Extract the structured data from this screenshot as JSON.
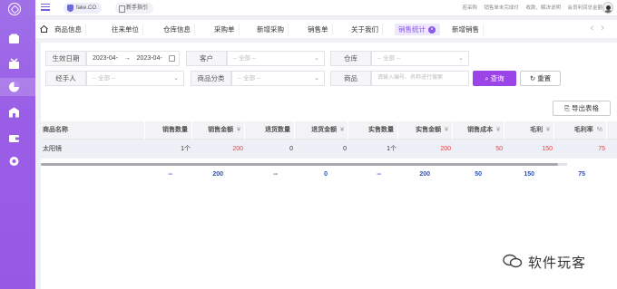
{
  "topbar": {
    "brand": "fake.CO",
    "guide": "新手指引",
    "right_items": [
      "若采购",
      "销售单未完成付",
      "收款、解决说明",
      "会员利润总金额"
    ]
  },
  "tabs": [
    {
      "label": "商品信息",
      "active": false
    },
    {
      "label": "往来单位",
      "active": false
    },
    {
      "label": "仓库信息",
      "active": false
    },
    {
      "label": "采购单",
      "active": false
    },
    {
      "label": "新增采购",
      "active": false
    },
    {
      "label": "销售单",
      "active": false
    },
    {
      "label": "关于我们",
      "active": false
    },
    {
      "label": "销售统计",
      "active": true
    },
    {
      "label": "新增销售",
      "active": false
    }
  ],
  "filters": {
    "date_label": "生效日期",
    "date_start": "2023-04-",
    "date_arrow": "→",
    "date_end": "2023-04-",
    "customer_label": "客户",
    "customer_placeholder": "-- 全部 --",
    "warehouse_label": "仓库",
    "warehouse_placeholder": "-- 全部 --",
    "handler_label": "经手人",
    "handler_placeholder": "-- 全部 --",
    "category_label": "商品分类",
    "category_placeholder": "-- 全部 --",
    "product_label": "商品",
    "product_placeholder": "请输入编号、名称进行搜索",
    "query_button": "查询",
    "reset_button": "重置",
    "export_button": "导出表格"
  },
  "table": {
    "columns": [
      {
        "label": "商品名称",
        "unit": ""
      },
      {
        "label": "销售数量",
        "unit": ""
      },
      {
        "label": "销售金额",
        "unit": "¥"
      },
      {
        "label": "退货数量",
        "unit": ""
      },
      {
        "label": "退货金额",
        "unit": "¥"
      },
      {
        "label": "实售数量",
        "unit": ""
      },
      {
        "label": "实售金额",
        "unit": "¥"
      },
      {
        "label": "销售成本",
        "unit": "¥"
      },
      {
        "label": "毛利",
        "unit": "¥"
      },
      {
        "label": "毛利率",
        "unit": "%"
      }
    ],
    "row": [
      "太阳镜",
      "1个",
      "200",
      "0",
      "0",
      "1个",
      "200",
      "50",
      "150",
      "75"
    ],
    "footer": [
      "",
      "--",
      "200",
      "--",
      "0",
      "--",
      "200",
      "50",
      "150",
      "75"
    ]
  },
  "watermark": "软件玩客",
  "colors": {
    "sidebar": "#9a5ee6",
    "accent": "#9b45e8",
    "red": "#e8413f",
    "footer_blue": "#2a4fb8"
  }
}
